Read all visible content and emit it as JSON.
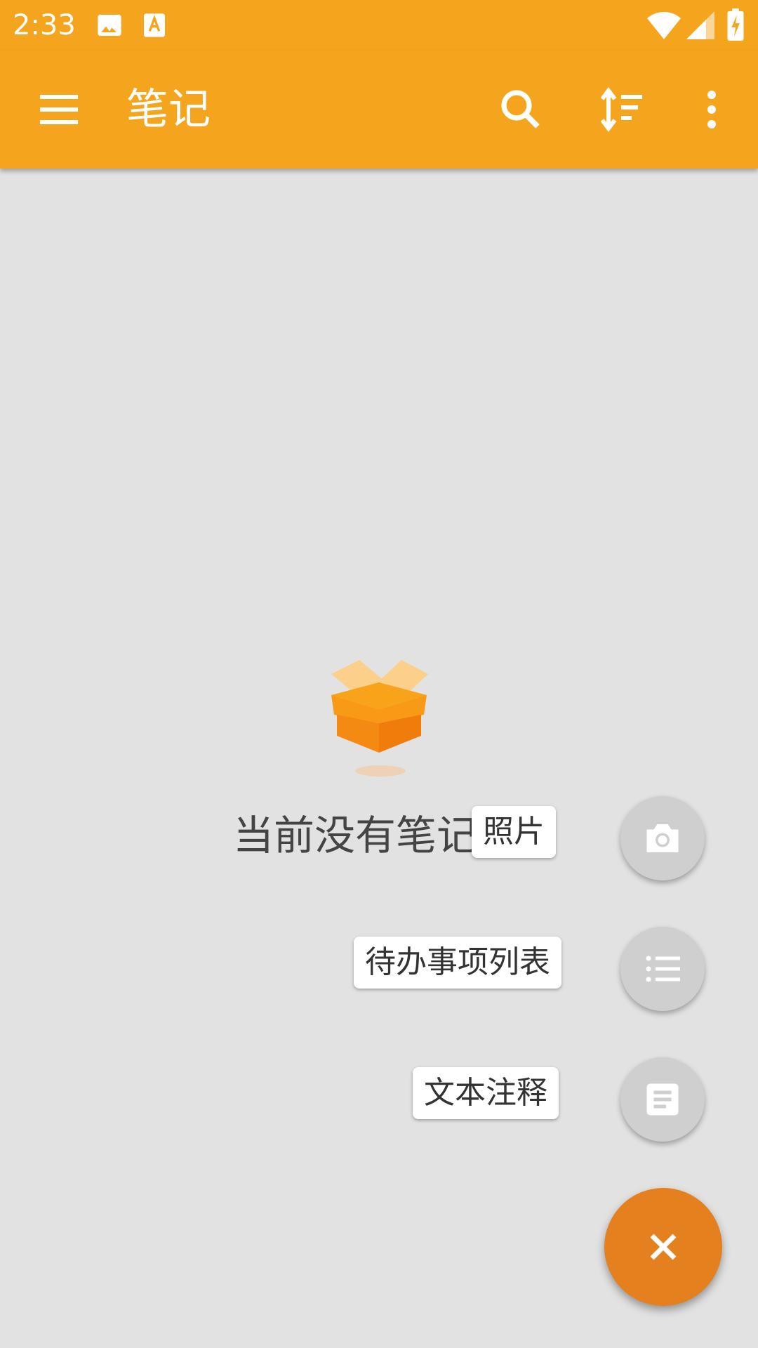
{
  "status_bar": {
    "time": "2:33",
    "icons": [
      "image-icon",
      "text-a-icon",
      "wifi-icon",
      "signal-icon",
      "battery-charging-icon"
    ]
  },
  "app_bar": {
    "title": "笔记",
    "icons": [
      "menu-icon",
      "search-icon",
      "sort-icon",
      "more-vert-icon"
    ]
  },
  "empty_state": {
    "icon": "open-box-icon",
    "text": "当前没有笔记"
  },
  "fab_menu": {
    "items": [
      {
        "label": "照片",
        "icon": "camera-icon"
      },
      {
        "label": "待办事项列表",
        "icon": "checklist-icon"
      },
      {
        "label": "文本注释",
        "icon": "note-icon"
      }
    ],
    "close_icon": "close-icon"
  },
  "colors": {
    "accent": "#f5a51d",
    "fab": "#e4801e",
    "background": "#e2e2e2",
    "mini_fab": "#cfcfcf"
  }
}
